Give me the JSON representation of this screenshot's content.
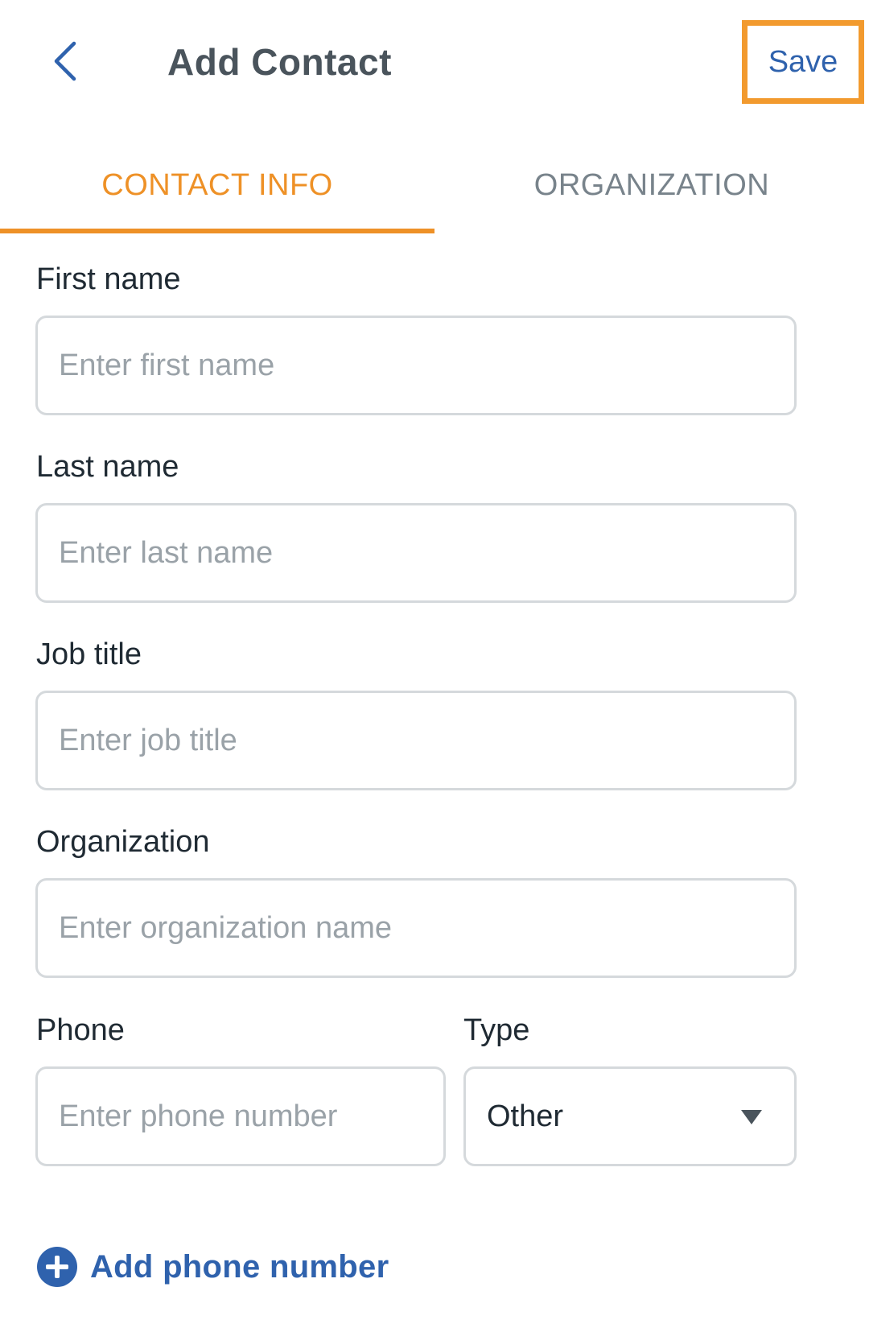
{
  "header": {
    "title": "Add Contact",
    "back_icon": "chevron-left-icon",
    "save_label": "Save"
  },
  "tabs": [
    {
      "label": "CONTACT INFO",
      "active": true
    },
    {
      "label": "ORGANIZATION",
      "active": false
    }
  ],
  "form": {
    "first_name": {
      "label": "First name",
      "placeholder": "Enter first name",
      "value": ""
    },
    "last_name": {
      "label": "Last name",
      "placeholder": "Enter last name",
      "value": ""
    },
    "job_title": {
      "label": "Job title",
      "placeholder": "Enter job title",
      "value": ""
    },
    "organization": {
      "label": "Organization",
      "placeholder": "Enter organization name",
      "value": ""
    },
    "phone": {
      "label": "Phone",
      "placeholder": "Enter phone number",
      "value": ""
    },
    "type": {
      "label": "Type",
      "value": "Other",
      "icon": "caret-down-icon"
    },
    "add_phone": {
      "label": "Add phone number",
      "icon": "plus-circle-icon"
    }
  },
  "colors": {
    "accent": "#ee9127",
    "link": "#2f62ad",
    "title": "#4a545c",
    "border": "#d5d9dc",
    "placeholder": "#9aa2a8"
  }
}
